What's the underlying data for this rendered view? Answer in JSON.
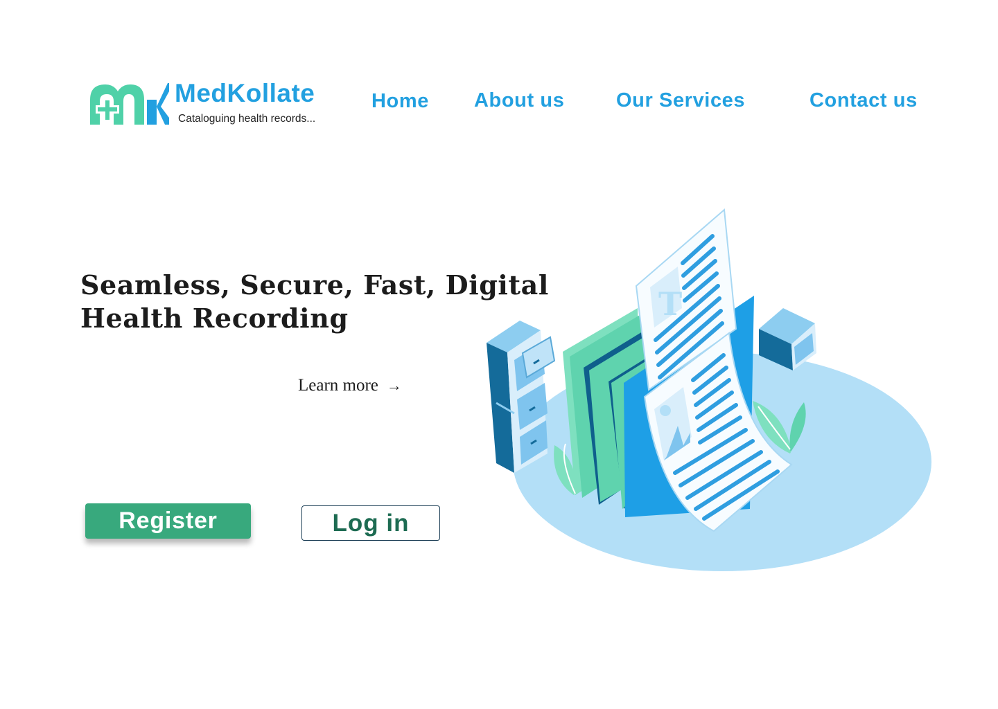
{
  "brand": {
    "name": "MedKollate",
    "tagline": "Cataloguing health records...",
    "logo_icon": "mk-logo-icon",
    "colors": {
      "blue": "#22a0e0",
      "green": "#4fd1a8"
    }
  },
  "nav": {
    "items": [
      {
        "label": "Home"
      },
      {
        "label": "About us"
      },
      {
        "label": "Our Services"
      },
      {
        "label": "Contact us"
      }
    ]
  },
  "hero": {
    "headline_line1": "Seamless, Secure, Fast, Digital",
    "headline_line2": "Health Recording",
    "learn_more_label": "Learn more",
    "learn_more_icon": "arrow-right-icon",
    "illustration": "health-records-illustration"
  },
  "actions": {
    "register_label": "Register",
    "login_label": "Log in"
  },
  "colors": {
    "accent_blue": "#22a0e0",
    "register_green": "#38a97d",
    "login_text": "#1d6b52"
  }
}
